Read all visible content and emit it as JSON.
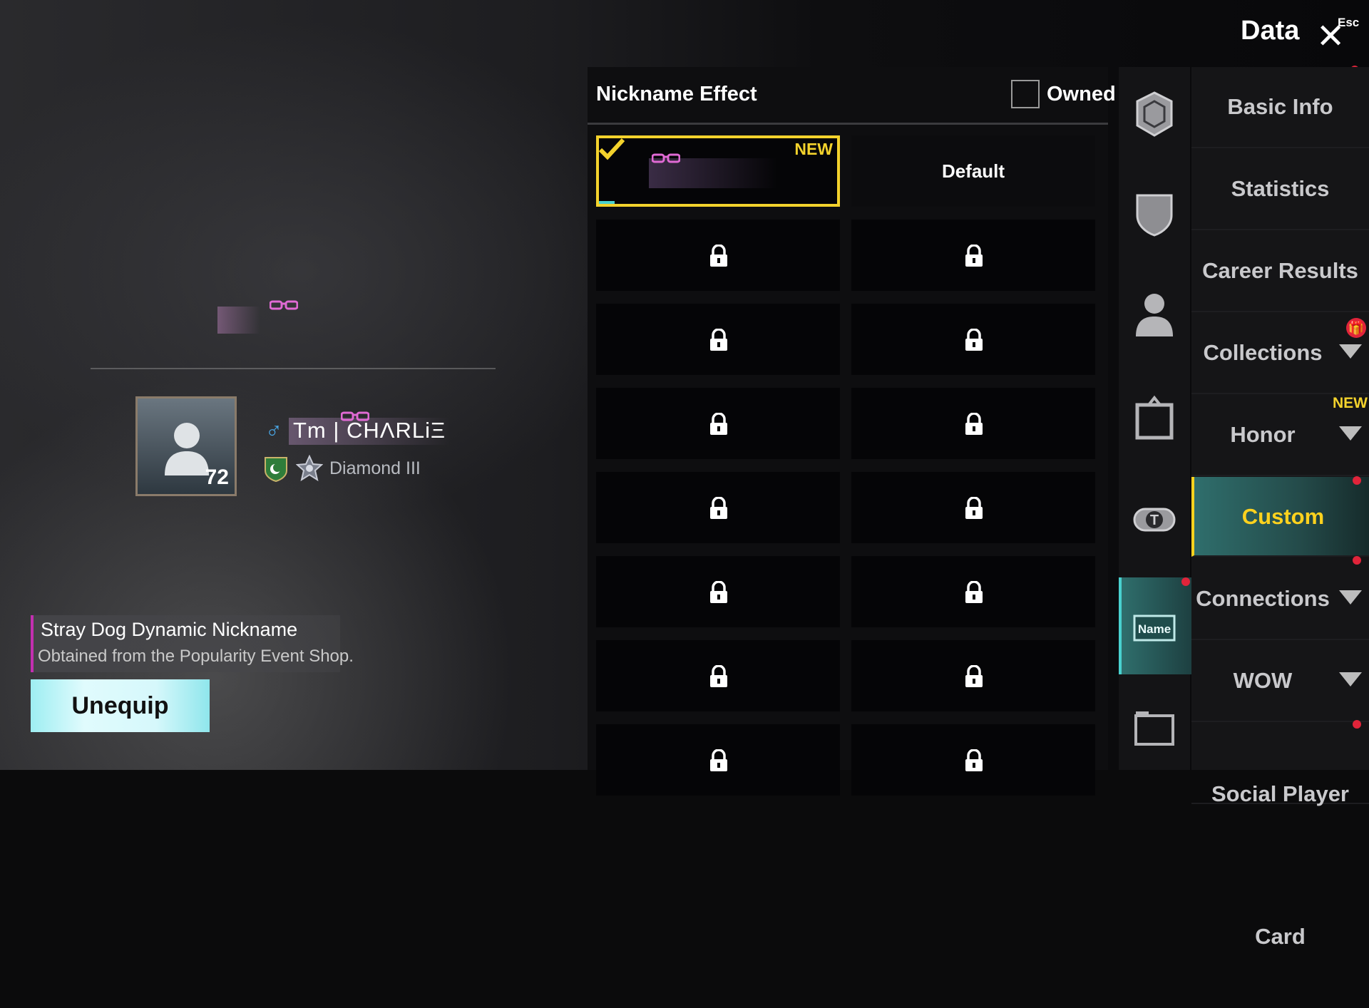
{
  "header": {
    "title": "Data",
    "close_label": "Esc"
  },
  "player": {
    "nickname": "Tm | CHΛRLiΞ",
    "level": "72",
    "rank": "Diamond III"
  },
  "selected_item": {
    "name": "Stray Dog Dynamic Nickname",
    "description": "Obtained from the Popularity Event Shop.",
    "unequip_label": "Unequip"
  },
  "panel": {
    "title": "Nickname Effect",
    "owned_label": "Owned",
    "new_tag": "NEW",
    "default_label": "Default",
    "locked_rows": 7
  },
  "nav": {
    "items": [
      {
        "label": "Basic Info",
        "has_arrow": false,
        "active": false
      },
      {
        "label": "Statistics",
        "has_arrow": false,
        "active": false
      },
      {
        "label": "Career Results",
        "has_arrow": false,
        "active": false
      },
      {
        "label": "Collections",
        "has_arrow": true,
        "active": false
      },
      {
        "label": "Honor",
        "has_arrow": true,
        "active": false
      },
      {
        "label": "Custom",
        "has_arrow": false,
        "active": true
      },
      {
        "label": "Connections",
        "has_arrow": true,
        "active": false
      },
      {
        "label": "WOW",
        "has_arrow": true,
        "active": false
      },
      {
        "label": "Social Player Card",
        "has_arrow": false,
        "active": false
      }
    ],
    "honor_new_tag": "NEW"
  },
  "icon_column": {
    "icons": [
      "emblem-icon",
      "shield-icon",
      "person-icon",
      "frame-icon",
      "title-icon",
      "name-tag-icon",
      "card-icon"
    ],
    "name_tag_label": "Name",
    "title_icon_letter": "T"
  },
  "colors": {
    "selected_border": "#f3d22c",
    "accent_teal": "#49d1cf",
    "active_nav_text": "#ffd21e",
    "notification_red": "#e0243a"
  }
}
